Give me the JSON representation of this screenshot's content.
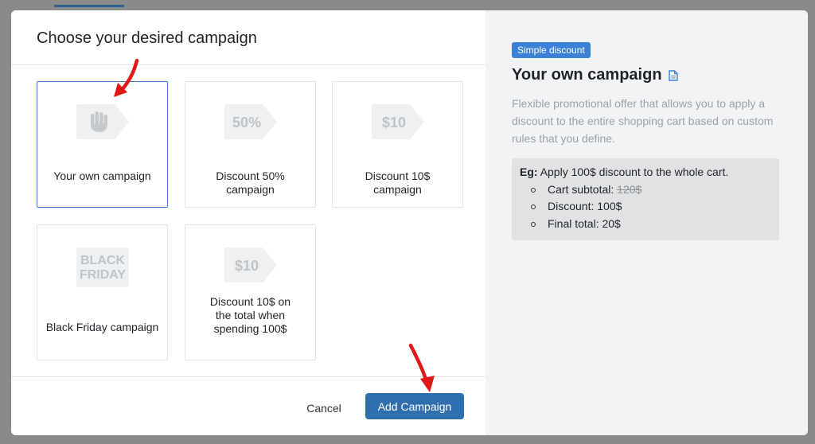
{
  "modal": {
    "title": "Choose your desired campaign",
    "cancel_label": "Cancel",
    "add_label": "Add Campaign"
  },
  "cards": [
    {
      "id": "own",
      "label": "Your own campaign",
      "tag_text": "",
      "icon": "hand-icon",
      "selected": true
    },
    {
      "id": "discount50",
      "label": "Discount 50% campaign",
      "tag_text": "50%",
      "icon": "percent-tag-icon",
      "selected": false
    },
    {
      "id": "discount10",
      "label": "Discount 10$ campaign",
      "tag_text": "$10",
      "icon": "price-tag-icon",
      "selected": false
    },
    {
      "id": "blackfriday",
      "label": "Black Friday campaign",
      "tag_text": "BLACK FRIDAY",
      "icon": "black-friday-tag-icon",
      "selected": false
    },
    {
      "id": "discount10over100",
      "label": "Discount 10$ on the total when spending 100$",
      "tag_text": "$10",
      "icon": "price-tag-icon",
      "selected": false
    }
  ],
  "detail": {
    "badge": "Simple discount",
    "heading": "Your own campaign",
    "description": "Flexible promotional offer that allows you to apply a discount to the entire shopping cart based on custom rules that you define.",
    "example_label": "Eg:",
    "example_text": "Apply 100$ discount to the whole cart.",
    "example_items": [
      {
        "label": "Cart subtotal: ",
        "value": "120$",
        "strike": true
      },
      {
        "label": "Discount: ",
        "value": "100$",
        "strike": false
      },
      {
        "label": "Final total: ",
        "value": "20$",
        "strike": false
      }
    ]
  },
  "colors": {
    "accent": "#2f6fad",
    "badge": "#3b82d6",
    "selected_border": "#3a78c3",
    "arrow": "#e01818"
  }
}
